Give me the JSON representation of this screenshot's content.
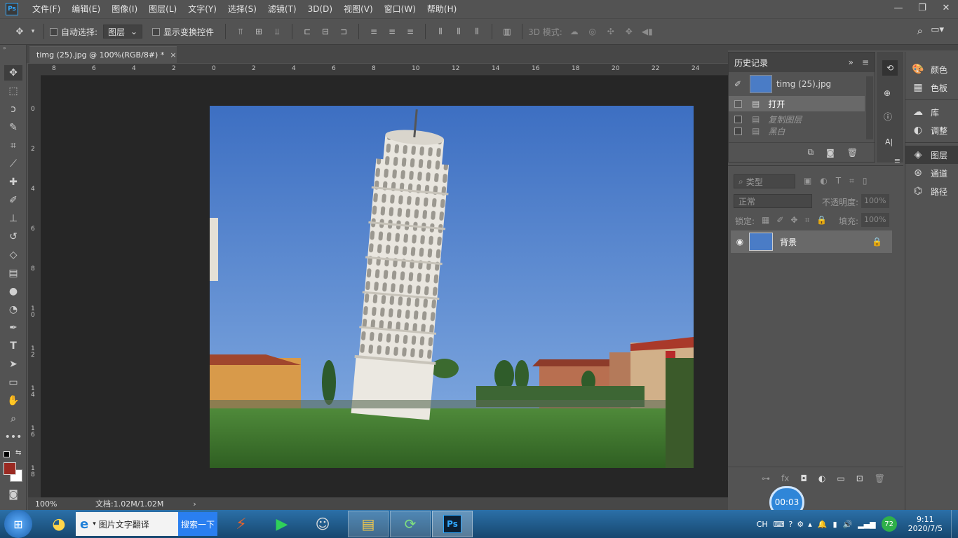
{
  "menu": {
    "logo": "Ps",
    "items": [
      "文件(F)",
      "编辑(E)",
      "图像(I)",
      "图层(L)",
      "文字(Y)",
      "选择(S)",
      "滤镜(T)",
      "3D(D)",
      "视图(V)",
      "窗口(W)",
      "帮助(H)"
    ]
  },
  "options": {
    "auto_select_label": "自动选择:",
    "auto_select_value": "图层",
    "show_transform_label": "显示变换控件",
    "mode_3d_label": "3D 模式:"
  },
  "document": {
    "tab_title": "timg (25).jpg @ 100%(RGB/8#) *",
    "ruler_top": [
      "8",
      "6",
      "4",
      "2",
      "0",
      "2",
      "4",
      "6",
      "8",
      "10",
      "12",
      "14",
      "16",
      "18",
      "20",
      "22",
      "24"
    ],
    "ruler_left": [
      "0",
      "2",
      "4",
      "6",
      "8",
      "1 0",
      "1 2",
      "1 4",
      "1 6",
      "1 8"
    ]
  },
  "status": {
    "zoom": "100%",
    "doc_info": "文档:1.02M/1.02M"
  },
  "history": {
    "title": "历史记录",
    "snapshot": "timg (25).jpg",
    "states": [
      "打开",
      "复制图层",
      "黑白"
    ]
  },
  "layers": {
    "filter_label": "类型",
    "blend_mode": "正常",
    "opacity_label": "不透明度:",
    "opacity_value": "100%",
    "lock_label": "锁定:",
    "fill_label": "填充:",
    "fill_value": "100%",
    "layer_name": "背景"
  },
  "dock": {
    "items": [
      "颜色",
      "色板",
      "库",
      "调整",
      "图层",
      "通道",
      "路径"
    ]
  },
  "timer": "00:03",
  "taskbar": {
    "ie_label": "图片文字翻译",
    "search_label": "搜索一下",
    "lang": "CH",
    "battery": "72",
    "time": "9:11",
    "date": "2020/7/5"
  },
  "colors": {
    "accent": "#31a8ff",
    "foreground_color": "#9a2a22",
    "background_color": "#ffffff"
  }
}
